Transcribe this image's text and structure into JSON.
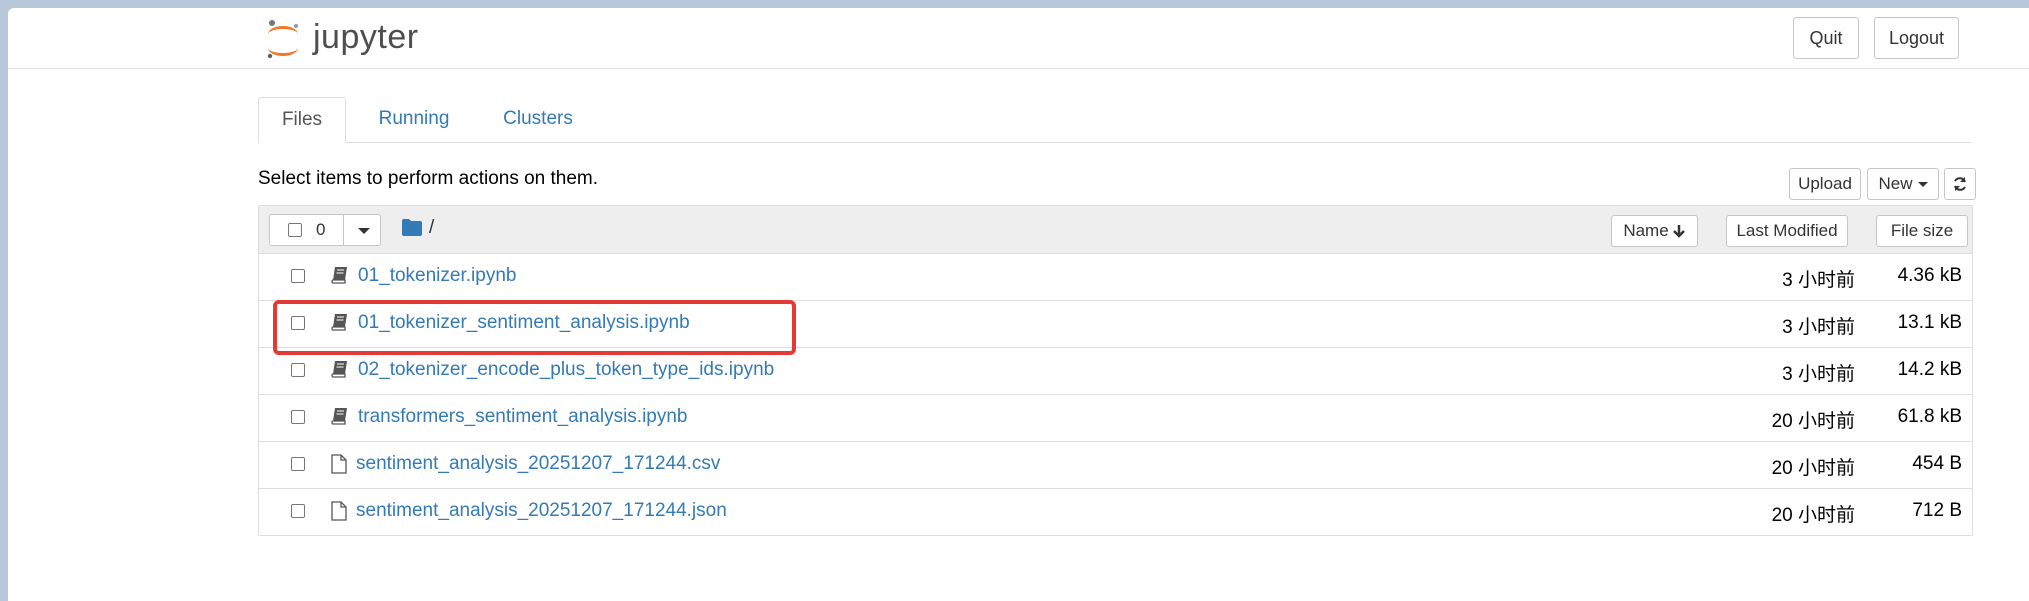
{
  "header": {
    "logo_text": "jupyter",
    "quit_label": "Quit",
    "logout_label": "Logout"
  },
  "tabs": [
    {
      "label": "Files",
      "active": true
    },
    {
      "label": "Running",
      "active": false
    },
    {
      "label": "Clusters",
      "active": false
    }
  ],
  "toolbar": {
    "instructions": "Select items to perform actions on them.",
    "upload_label": "Upload",
    "new_label": "New"
  },
  "list_header": {
    "selected_count": "0",
    "path": "/",
    "name_label": "Name",
    "modified_label": "Last Modified",
    "size_label": "File size"
  },
  "files": [
    {
      "name": "01_tokenizer.ipynb",
      "type": "notebook",
      "modified": "3 小时前",
      "size": "4.36 kB"
    },
    {
      "name": "01_tokenizer_sentiment_analysis.ipynb",
      "type": "notebook",
      "modified": "3 小时前",
      "size": "13.1 kB"
    },
    {
      "name": "02_tokenizer_encode_plus_token_type_ids.ipynb",
      "type": "notebook",
      "modified": "3 小时前",
      "size": "14.2 kB"
    },
    {
      "name": "transformers_sentiment_analysis.ipynb",
      "type": "notebook",
      "modified": "20 小时前",
      "size": "61.8 kB"
    },
    {
      "name": "sentiment_analysis_20251207_171244.csv",
      "type": "file",
      "modified": "20 小时前",
      "size": "454 B"
    },
    {
      "name": "sentiment_analysis_20251207_171244.json",
      "type": "file",
      "modified": "20 小时前",
      "size": "712 B"
    }
  ],
  "colors": {
    "link": "#337ab7",
    "highlight": "#e53935",
    "logo_orange": "#f37726"
  },
  "icons": {
    "notebook": "book-icon",
    "file": "file-icon",
    "folder": "folder-icon",
    "refresh": "refresh-icon",
    "sort": "arrow-down-icon"
  }
}
